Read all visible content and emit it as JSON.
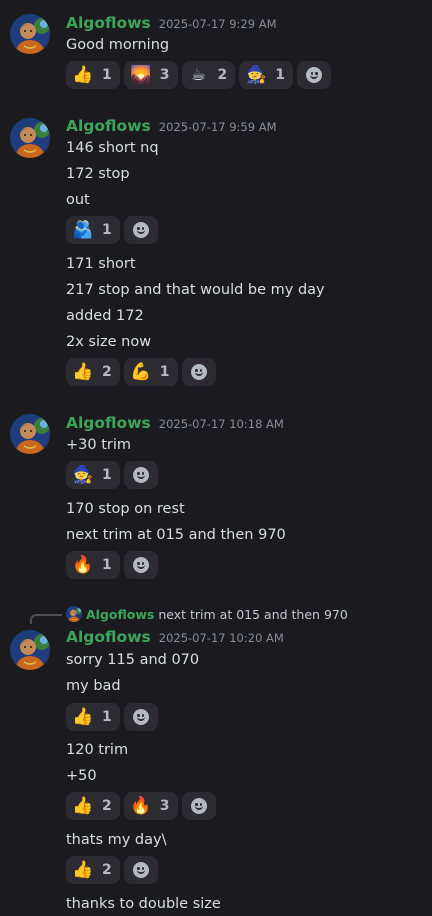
{
  "groups": [
    {
      "username": "Algoflows",
      "timestamp": "2025-07-17 9:29 AM",
      "lines": [
        "Good morning"
      ],
      "reactions": [
        {
          "emoji": "👍",
          "name": "thumbs-up-icon",
          "count": "1"
        },
        {
          "emoji": "🌄",
          "name": "sunrise-icon",
          "count": "3"
        },
        {
          "emoji": "☕",
          "name": "coffee-icon",
          "count": "2"
        },
        {
          "emoji": "🧙",
          "name": "wizard-icon",
          "count": "1"
        }
      ]
    },
    {
      "username": "Algoflows",
      "timestamp": "2025-07-17 9:59 AM",
      "lines": [
        "146 short nq",
        "172 stop",
        "out",
        "171 short",
        "217 stop and that would be my day",
        "added 172",
        "2x size now"
      ],
      "reactions_a": [
        {
          "emoji": "🫂",
          "name": "hug-icon",
          "count": "1"
        }
      ],
      "reactions_b": [
        {
          "emoji": "👍",
          "name": "thumbs-up-icon",
          "count": "2"
        },
        {
          "emoji": "💪",
          "name": "flexed-biceps-icon",
          "count": "1"
        }
      ]
    },
    {
      "username": "Algoflows",
      "timestamp": "2025-07-17 10:18 AM",
      "lines": [
        "+30 trim",
        "170 stop on rest",
        "next trim at 015 and then 970"
      ],
      "reactions_a": [
        {
          "emoji": "🧙",
          "name": "wizard-icon",
          "count": "1"
        }
      ],
      "reactions_b": [
        {
          "emoji": "🔥",
          "name": "fire-icon",
          "count": "1"
        }
      ]
    },
    {
      "reply": {
        "username": "Algoflows",
        "text": "next trim at 015 and then 970"
      },
      "username": "Algoflows",
      "timestamp": "2025-07-17 10:20 AM",
      "lines": [
        "sorry 115 and 070",
        "my bad",
        "120 trim",
        "+50",
        "thats my day\\",
        "thanks to double size"
      ],
      "reactions_a": [
        {
          "emoji": "👍",
          "name": "thumbs-up-icon",
          "count": "1"
        }
      ],
      "reactions_b": [
        {
          "emoji": "👍",
          "name": "thumbs-up-icon",
          "count": "2"
        },
        {
          "emoji": "🔥",
          "name": "fire-icon",
          "count": "3"
        }
      ],
      "reactions_c": [
        {
          "emoji": "👍",
          "name": "thumbs-up-icon",
          "count": "2"
        }
      ]
    }
  ],
  "colors": {
    "username": "#3ba55c",
    "background": "#1b1b1f",
    "pill": "#2b2b31"
  }
}
